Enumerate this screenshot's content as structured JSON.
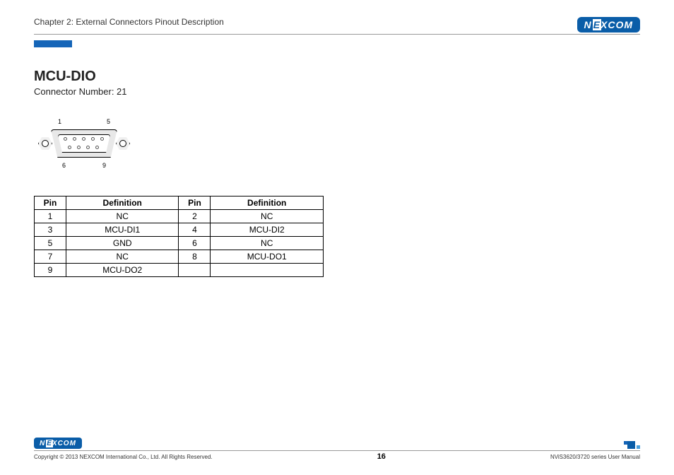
{
  "header": {
    "chapter": "Chapter 2: External Connectors Pinout Description",
    "brand": "NEXCOM"
  },
  "section": {
    "title": "MCU-DIO",
    "subtitle": "Connector Number: 21"
  },
  "diagram": {
    "top_left_pin": "1",
    "top_right_pin": "5",
    "bottom_left_pin": "6",
    "bottom_right_pin": "9"
  },
  "table": {
    "headers": {
      "pin": "Pin",
      "definition": "Definition"
    },
    "rows": [
      {
        "pin_a": "1",
        "def_a": "NC",
        "pin_b": "2",
        "def_b": "NC"
      },
      {
        "pin_a": "3",
        "def_a": "MCU-DI1",
        "pin_b": "4",
        "def_b": "MCU-DI2"
      },
      {
        "pin_a": "5",
        "def_a": "GND",
        "pin_b": "6",
        "def_b": "NC"
      },
      {
        "pin_a": "7",
        "def_a": "NC",
        "pin_b": "8",
        "def_b": "MCU-DO1"
      },
      {
        "pin_a": "9",
        "def_a": "MCU-DO2",
        "pin_b": "",
        "def_b": ""
      }
    ]
  },
  "footer": {
    "copyright": "Copyright © 2013 NEXCOM International Co., Ltd. All Rights Reserved.",
    "page": "16",
    "manual": "NViS3620/3720 series User Manual"
  }
}
